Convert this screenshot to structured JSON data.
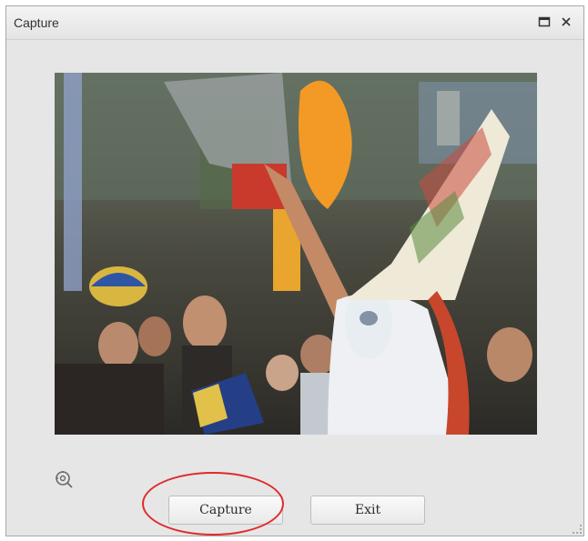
{
  "window": {
    "title": "Capture"
  },
  "title_bar": {
    "maximize_icon": "maximize-icon",
    "close_icon": "close-icon"
  },
  "preview": {
    "description": "",
    "icon": "camera-preview"
  },
  "settings": {
    "icon": "camera-settings-icon"
  },
  "buttons": {
    "capture_label": "Capture",
    "exit_label": "Exit"
  },
  "annotation": {
    "highlight_color": "#e02a2a"
  },
  "colors": {
    "window_bg": "#e6e6e6",
    "button_bg": "#f2f2f2"
  }
}
